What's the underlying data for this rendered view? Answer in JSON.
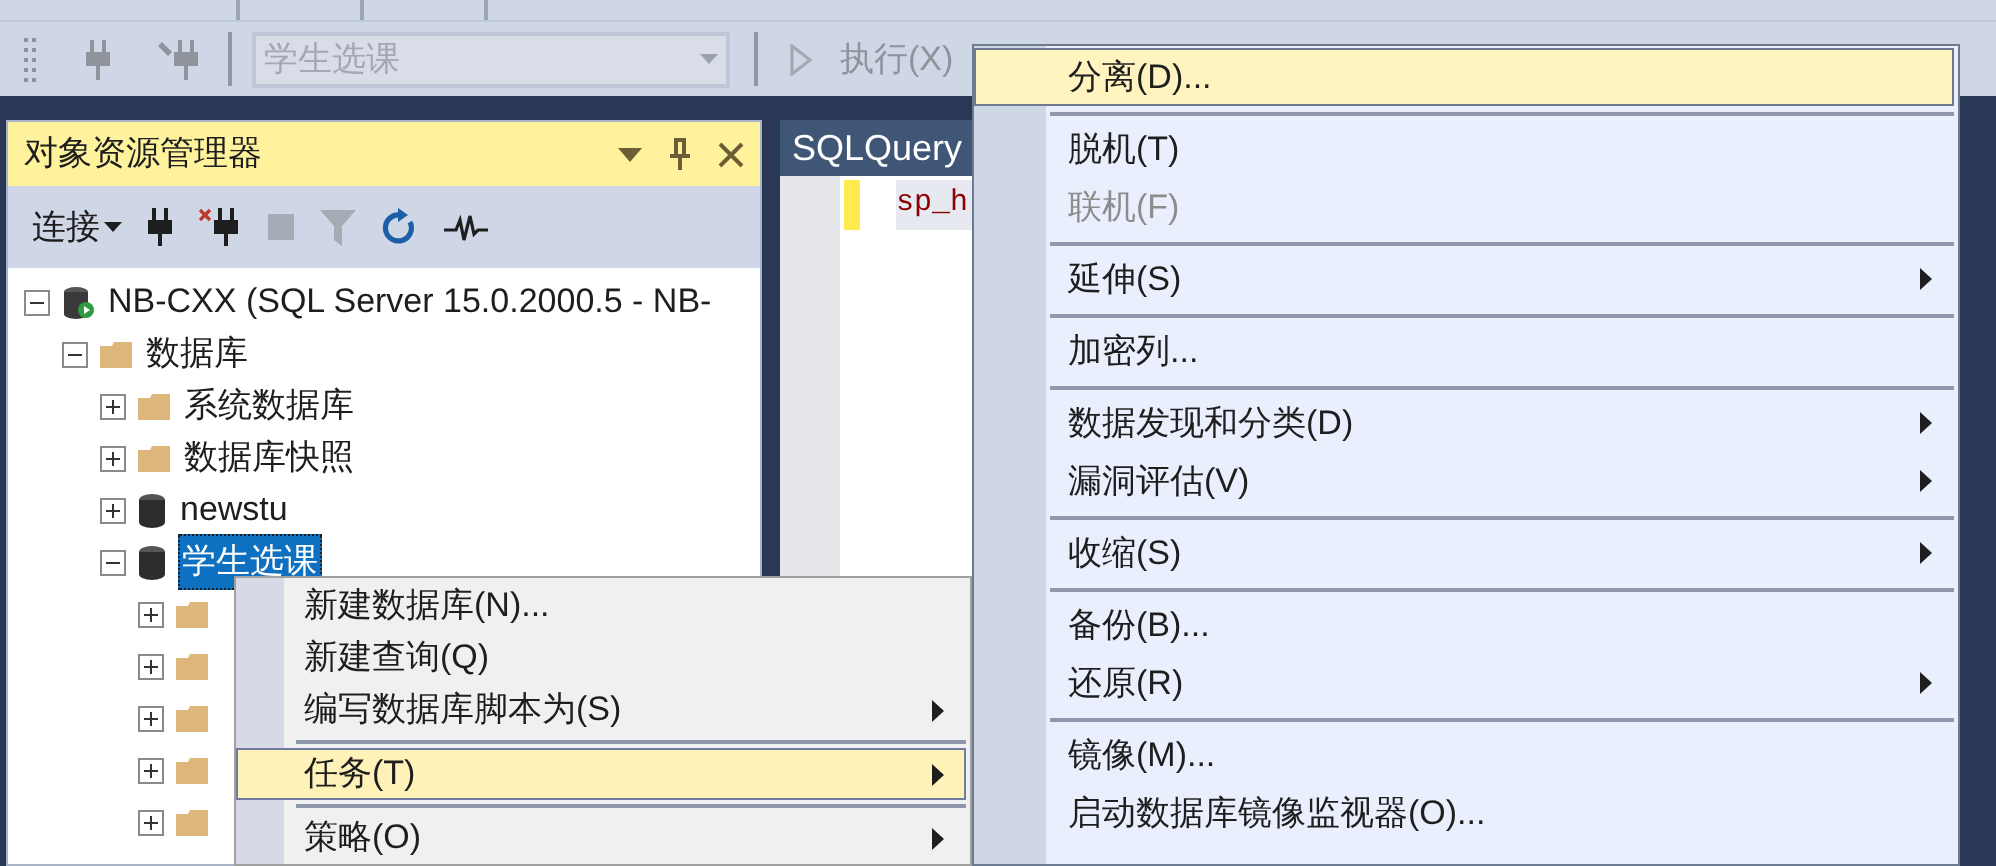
{
  "toolbar": {
    "database_select": "学生选课",
    "execute_button": "执行(X)"
  },
  "object_explorer": {
    "title": "对象资源管理器",
    "connect_button": "连接",
    "tree": [
      {
        "label": "NB-CXX (SQL Server 15.0.2000.5 - NB-",
        "kind": "server",
        "expanded": true,
        "selected": false,
        "children": [
          {
            "label": "数据库",
            "kind": "folder",
            "expanded": true,
            "selected": false,
            "children": [
              {
                "label": "系统数据库",
                "kind": "folder",
                "expanded": false,
                "selected": false
              },
              {
                "label": "数据库快照",
                "kind": "folder",
                "expanded": false,
                "selected": false
              },
              {
                "label": "newstu",
                "kind": "database",
                "expanded": false,
                "selected": false
              },
              {
                "label": "学生选课",
                "kind": "database",
                "expanded": true,
                "selected": true,
                "children": [
                  {
                    "kind": "folder",
                    "expanded": false
                  },
                  {
                    "kind": "folder",
                    "expanded": false
                  },
                  {
                    "kind": "folder",
                    "expanded": false
                  },
                  {
                    "kind": "folder",
                    "expanded": false
                  },
                  {
                    "kind": "folder",
                    "expanded": false
                  }
                ]
              }
            ]
          }
        ]
      }
    ]
  },
  "editor": {
    "tab": "SQLQuery",
    "code": "sp_h"
  },
  "context_menu": {
    "items": [
      {
        "label": "新建数据库(N)...",
        "submenu": false,
        "selected": false,
        "separator_before": false
      },
      {
        "label": "新建查询(Q)",
        "submenu": false,
        "selected": false,
        "separator_before": false
      },
      {
        "label": "编写数据库脚本为(S)",
        "submenu": true,
        "selected": false,
        "separator_before": false
      },
      {
        "label": "任务(T)",
        "submenu": true,
        "selected": true,
        "separator_before": true
      },
      {
        "label": "策略(O)",
        "submenu": true,
        "selected": false,
        "separator_before": true
      }
    ]
  },
  "tasks_submenu": {
    "items": [
      {
        "label": "分离(D)...",
        "submenu": false,
        "selected": true,
        "disabled": false,
        "separator_before": false
      },
      {
        "label": "脱机(T)",
        "submenu": false,
        "selected": false,
        "disabled": false,
        "separator_before": true
      },
      {
        "label": "联机(F)",
        "submenu": false,
        "selected": false,
        "disabled": true,
        "separator_before": false
      },
      {
        "label": "延伸(S)",
        "submenu": true,
        "selected": false,
        "disabled": false,
        "separator_before": true
      },
      {
        "label": "加密列...",
        "submenu": false,
        "selected": false,
        "disabled": false,
        "separator_before": true
      },
      {
        "label": "数据发现和分类(D)",
        "submenu": true,
        "selected": false,
        "disabled": false,
        "separator_before": true
      },
      {
        "label": "漏洞评估(V)",
        "submenu": true,
        "selected": false,
        "disabled": false,
        "separator_before": false
      },
      {
        "label": "收缩(S)",
        "submenu": true,
        "selected": false,
        "disabled": false,
        "separator_before": true
      },
      {
        "label": "备份(B)...",
        "submenu": false,
        "selected": false,
        "disabled": false,
        "separator_before": true
      },
      {
        "label": "还原(R)",
        "submenu": true,
        "selected": false,
        "disabled": false,
        "separator_before": false
      },
      {
        "label": "镜像(M)...",
        "submenu": false,
        "selected": false,
        "disabled": false,
        "separator_before": true
      },
      {
        "label": "启动数据库镜像监视器(O)...",
        "submenu": false,
        "selected": false,
        "disabled": false,
        "separator_before": false
      }
    ]
  }
}
